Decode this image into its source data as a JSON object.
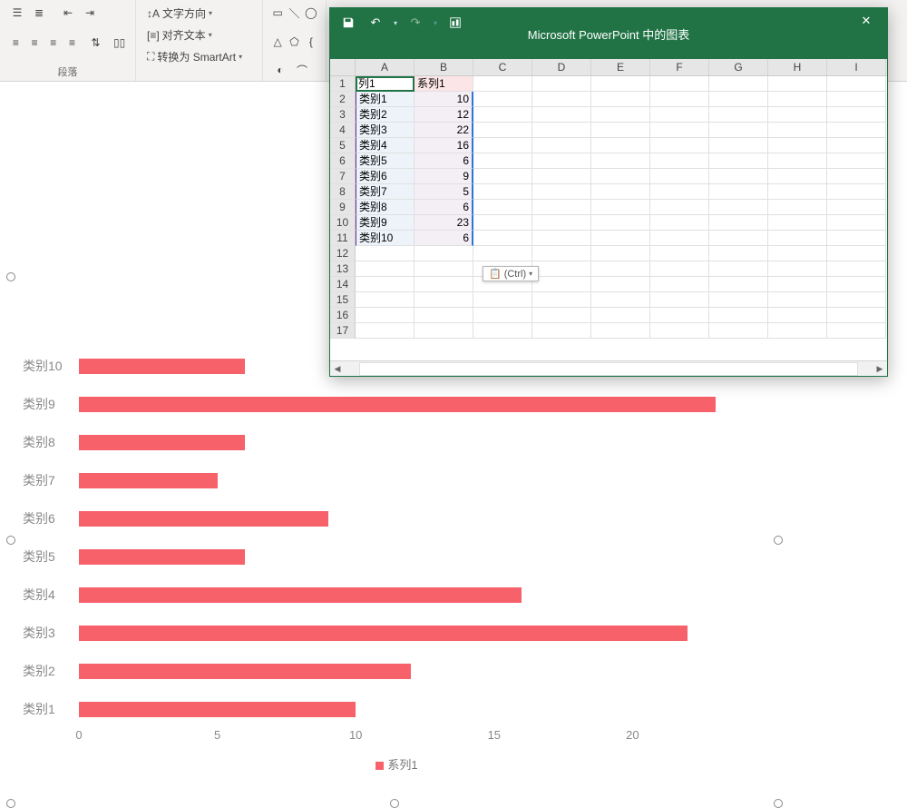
{
  "ribbon": {
    "text_direction": "文字方向",
    "align_text": "对齐文本",
    "convert_smartart": "转换为 SmartArt",
    "group_paragraph": "段落"
  },
  "excel": {
    "window_title": "Microsoft PowerPoint 中的图表",
    "paste_options": "(Ctrl)",
    "columns": [
      "A",
      "B",
      "C",
      "D",
      "E",
      "F",
      "G",
      "H",
      "I"
    ],
    "header_row": {
      "a": "列1",
      "b": "系列1"
    },
    "rows": [
      {
        "n": 1
      },
      {
        "n": 2,
        "a": "类别1",
        "b": 10
      },
      {
        "n": 3,
        "a": "类别2",
        "b": 12
      },
      {
        "n": 4,
        "a": "类别3",
        "b": 22
      },
      {
        "n": 5,
        "a": "类别4",
        "b": 16
      },
      {
        "n": 6,
        "a": "类别5",
        "b": 6
      },
      {
        "n": 7,
        "a": "类别6",
        "b": 9
      },
      {
        "n": 8,
        "a": "类别7",
        "b": 5
      },
      {
        "n": 9,
        "a": "类别8",
        "b": 6
      },
      {
        "n": 10,
        "a": "类别9",
        "b": 23
      },
      {
        "n": 11,
        "a": "类别10",
        "b": 6
      },
      {
        "n": 12
      },
      {
        "n": 13
      },
      {
        "n": 14
      },
      {
        "n": 15
      },
      {
        "n": 16
      },
      {
        "n": 17
      }
    ]
  },
  "chart_data": {
    "type": "bar",
    "title": "",
    "xlabel": "",
    "ylabel": "",
    "xlim": [
      0,
      25
    ],
    "x_ticks": [
      0,
      5,
      10,
      15,
      20
    ],
    "categories": [
      "类别10",
      "类别9",
      "类别8",
      "类别7",
      "类别6",
      "类别5",
      "类别4",
      "类别3",
      "类别2",
      "类别1"
    ],
    "values": [
      6,
      23,
      6,
      5,
      9,
      6,
      16,
      22,
      12,
      10
    ],
    "series_name": "系列1",
    "color": "#f6616a",
    "legend_position": "bottom"
  }
}
